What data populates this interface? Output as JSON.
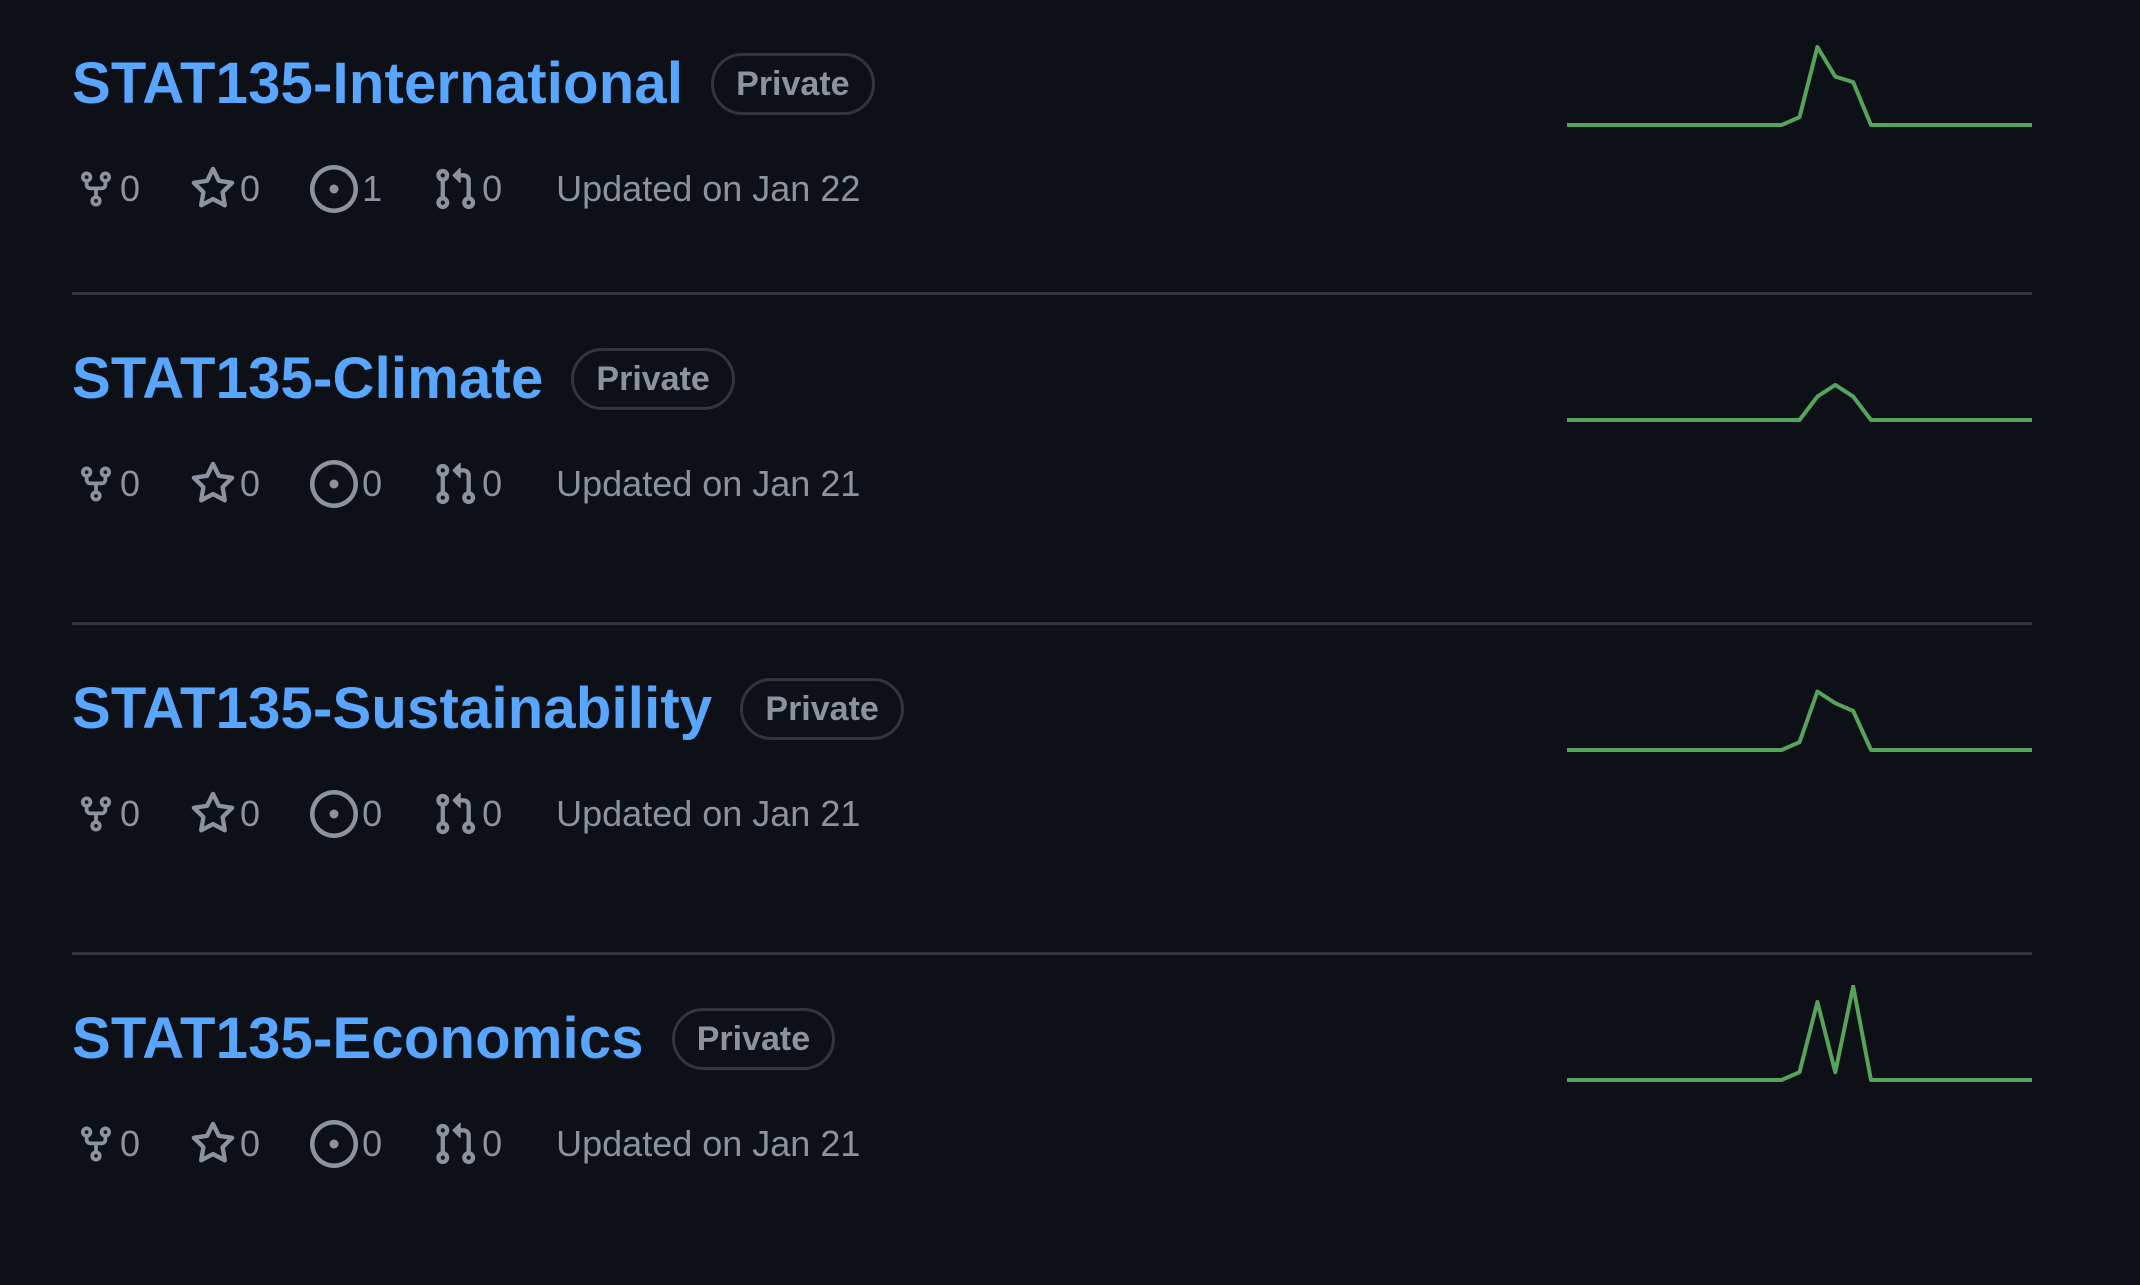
{
  "repos": [
    {
      "name": "STAT135-International",
      "visibility": "Private",
      "forks": "0",
      "stars": "0",
      "issues": "1",
      "pull_requests": "0",
      "updated": "Updated on Jan 22",
      "activity": [
        0,
        0,
        0,
        0,
        0,
        0,
        0,
        0,
        0,
        0,
        0,
        0,
        0,
        0.1,
        1,
        0.62,
        0.55,
        0,
        0,
        0,
        0,
        0,
        0,
        0,
        0,
        0,
        0
      ]
    },
    {
      "name": "STAT135-Climate",
      "visibility": "Private",
      "forks": "0",
      "stars": "0",
      "issues": "0",
      "pull_requests": "0",
      "updated": "Updated on Jan 21",
      "activity": [
        0,
        0,
        0,
        0,
        0,
        0,
        0,
        0,
        0,
        0,
        0,
        0,
        0,
        0,
        0.3,
        0.45,
        0.3,
        0,
        0,
        0,
        0,
        0,
        0,
        0,
        0,
        0,
        0
      ]
    },
    {
      "name": "STAT135-Sustainability",
      "visibility": "Private",
      "forks": "0",
      "stars": "0",
      "issues": "0",
      "pull_requests": "0",
      "updated": "Updated on Jan 21",
      "activity": [
        0,
        0,
        0,
        0,
        0,
        0,
        0,
        0,
        0,
        0,
        0,
        0,
        0,
        0.1,
        0.75,
        0.6,
        0.5,
        0,
        0,
        0,
        0,
        0,
        0,
        0,
        0,
        0,
        0
      ]
    },
    {
      "name": "STAT135-Economics",
      "visibility": "Private",
      "forks": "0",
      "stars": "0",
      "issues": "0",
      "pull_requests": "0",
      "updated": "Updated on Jan 21",
      "activity": [
        0,
        0,
        0,
        0,
        0,
        0,
        0,
        0,
        0,
        0,
        0,
        0,
        0,
        0.1,
        1,
        0.1,
        1.2,
        0,
        0,
        0,
        0,
        0,
        0,
        0,
        0,
        0,
        0
      ]
    }
  ],
  "colors": {
    "link": "#58a6ff",
    "muted": "#8b949e",
    "border": "#30363d",
    "background": "#0d1117",
    "spark_line": "#56a35b"
  },
  "icons": {
    "fork": "fork-icon",
    "star": "star-icon",
    "issue": "issue-icon",
    "pull_request": "pull-request-icon"
  }
}
